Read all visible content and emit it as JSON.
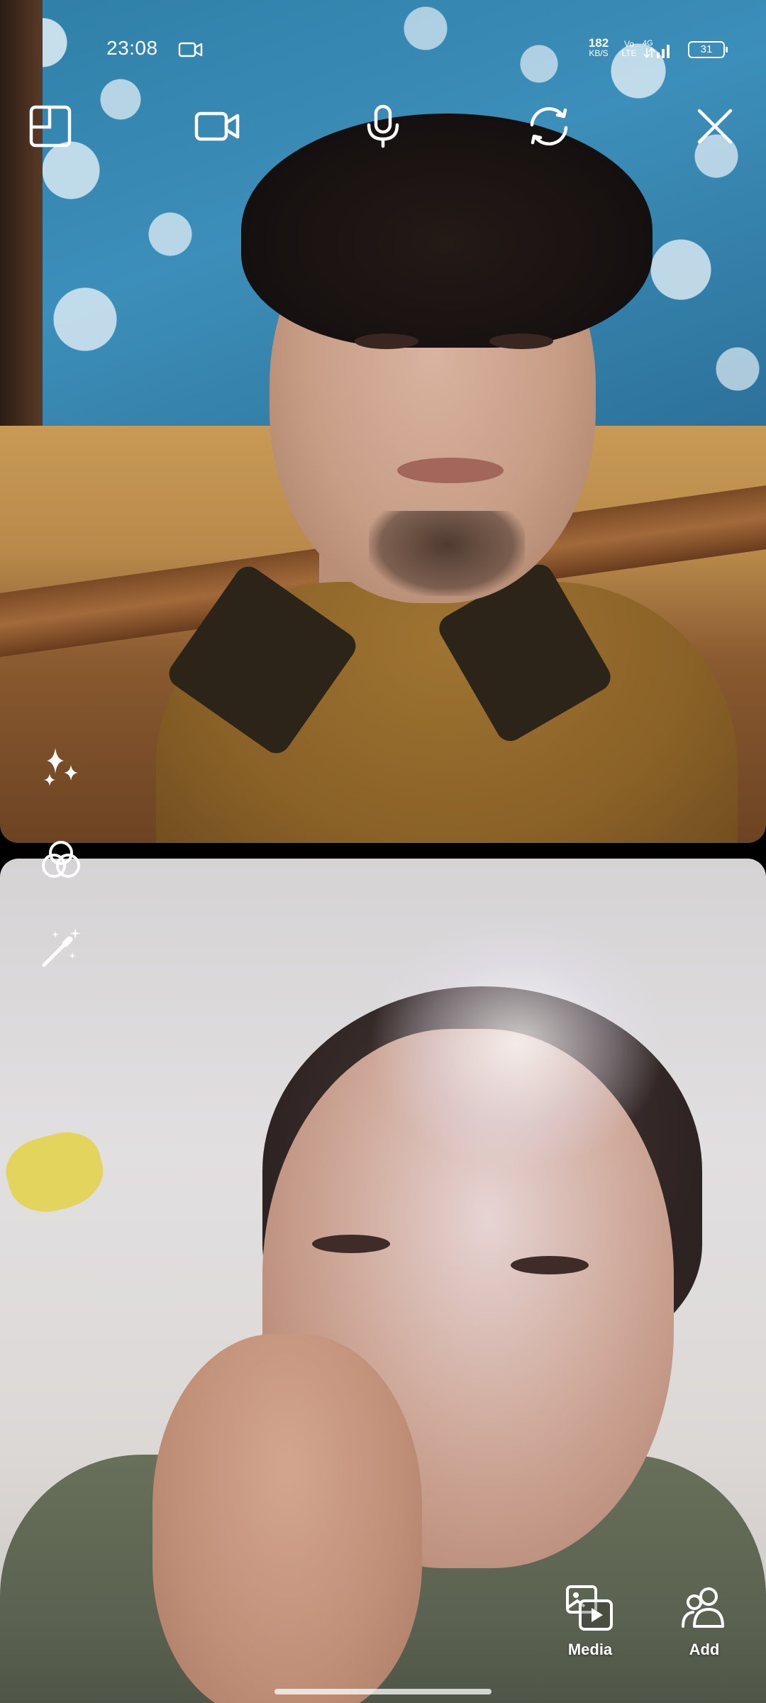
{
  "status_bar": {
    "time": "23:08",
    "net_speed_value": "182",
    "net_speed_unit": "KB/S",
    "volte_top": "Vo",
    "volte_bottom": "LTE",
    "network_type": "4G",
    "battery_level": "31",
    "icons": [
      "screen-record-icon",
      "volte-icon",
      "signal-icon",
      "battery-icon"
    ]
  },
  "call_controls": {
    "icons": [
      "pip-icon",
      "video-camera-icon",
      "microphone-icon",
      "switch-camera-icon",
      "close-icon"
    ]
  },
  "effects_toolbar": {
    "icons": [
      "sparkles-icon",
      "filters-icon",
      "magic-wand-icon"
    ]
  },
  "bottom_actions": {
    "media_label": "Media",
    "add_label": "Add"
  },
  "colors": {
    "icon": "#ffffff",
    "background": "#000000"
  }
}
